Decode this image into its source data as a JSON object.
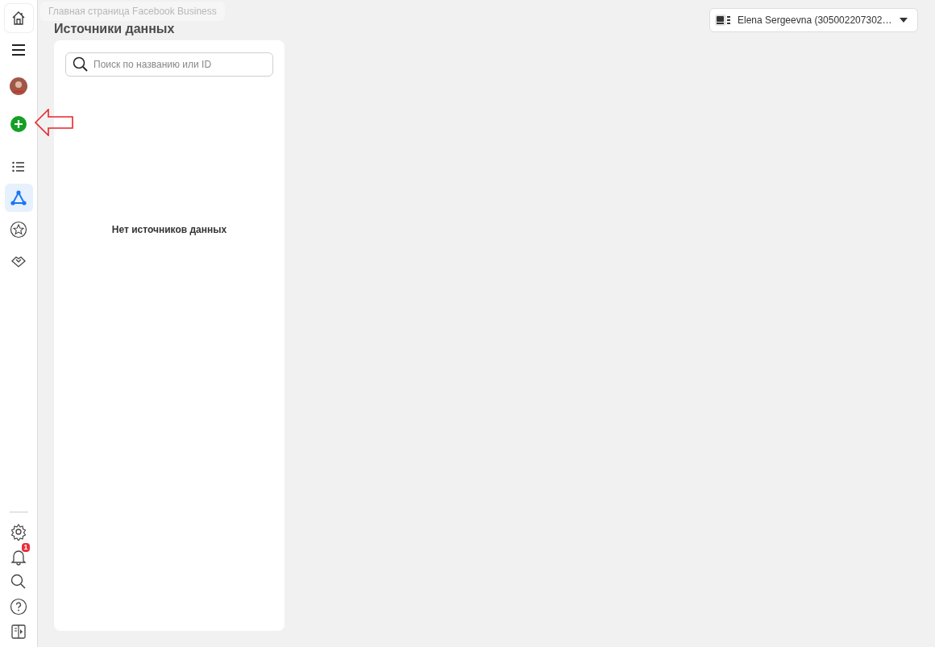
{
  "sidebar": {
    "top_items": [
      {
        "kind": "home",
        "selected": false,
        "hovered": true
      },
      {
        "kind": "menu",
        "selected": false,
        "hovered": false
      },
      {
        "kind": "avatar",
        "selected": false,
        "hovered": false
      },
      {
        "kind": "add",
        "selected": false,
        "hovered": false
      },
      {
        "kind": "list",
        "selected": false,
        "hovered": false
      },
      {
        "kind": "nodes",
        "selected": true,
        "hovered": false
      },
      {
        "kind": "star",
        "selected": false,
        "hovered": false
      },
      {
        "kind": "handshake",
        "selected": false,
        "hovered": false
      }
    ],
    "bottom_items": [
      {
        "kind": "settings"
      },
      {
        "kind": "bell",
        "badge": "1"
      },
      {
        "kind": "search"
      },
      {
        "kind": "help"
      },
      {
        "kind": "panel"
      }
    ]
  },
  "tooltip": "Главная страница Facebook Business",
  "page_title": "Источники данных",
  "account_selector": {
    "label": "Elena Sergeevna (305002207302…"
  },
  "panel": {
    "search": {
      "placeholder": "Поиск по названию или ID"
    },
    "empty_message": "Нет источников данных"
  }
}
